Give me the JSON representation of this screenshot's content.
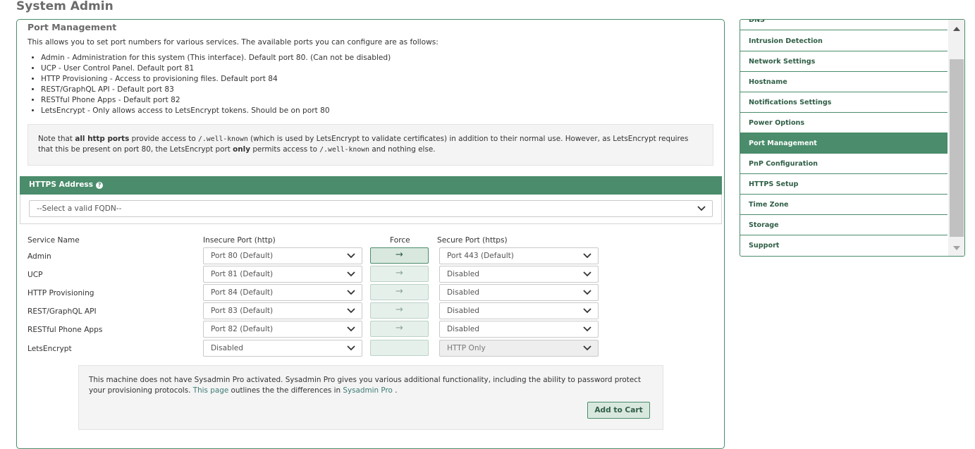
{
  "page_title": "System Admin",
  "panel": {
    "title": "Port Management",
    "intro": "This allows you to set port numbers for various services. The available ports you can configure are as follows:",
    "list": [
      "Admin - Administration for this system (This interface). Default port 80. (Can not be disabled)",
      "UCP - User Control Panel. Default port 81",
      "HTTP Provisioning - Access to provisioning files. Default port 84",
      "REST/GraphQL API - Default port 83",
      "RESTful Phone Apps - Default port 82",
      "LetsEncrypt - Only allows access to LetsEncrypt tokens. Should be on port 80"
    ]
  },
  "note": {
    "p1": "Note that ",
    "bold1": "all http ports",
    "p2": " provide access to ",
    "code1": "/.well-known",
    "p3": " (which is used by LetsEncrypt to validate certificates) in addition to their normal use. However, as LetsEncrypt requires that this be present on port 80, the LetsEncrypt port ",
    "bold2": "only",
    "p4": " permits access to ",
    "code2": "/.well-known",
    "p5": " and nothing else."
  },
  "https": {
    "label": "HTTPS Address",
    "help_icon": "question-circle-icon",
    "placeholder": "--Select a valid FQDN--"
  },
  "table": {
    "headers": {
      "service": "Service Name",
      "insecure": "Insecure Port (http)",
      "force": "Force",
      "secure": "Secure Port (https)"
    },
    "force_icon": "→",
    "rows": [
      {
        "service": "Admin",
        "insecure": "Port 80 (Default)",
        "secure": "Port 443 (Default)",
        "force": "active",
        "secure_disabled": false
      },
      {
        "service": "UCP",
        "insecure": "Port 81 (Default)",
        "secure": "Disabled",
        "force": "inactive",
        "secure_disabled": false
      },
      {
        "service": "HTTP Provisioning",
        "insecure": "Port 84 (Default)",
        "secure": "Disabled",
        "force": "inactive",
        "secure_disabled": false
      },
      {
        "service": "REST/GraphQL API",
        "insecure": "Port 83 (Default)",
        "secure": "Disabled",
        "force": "inactive",
        "secure_disabled": false
      },
      {
        "service": "RESTful Phone Apps",
        "insecure": "Port 82 (Default)",
        "secure": "Disabled",
        "force": "inactive",
        "secure_disabled": false
      },
      {
        "service": "LetsEncrypt",
        "insecure": "Disabled",
        "secure": "HTTP Only",
        "force": "empty",
        "secure_disabled": true
      }
    ]
  },
  "pro": {
    "text1": "This machine does not have Sysadmin Pro activated. Sysadmin Pro gives you various additional functionality, including the ability to password protect your provisioning protocols. ",
    "link1": "This page",
    "text2": " outlines the the differences in ",
    "link2": "Sysadmin Pro",
    "text3": " .",
    "button": "Add to Cart"
  },
  "sidebar": {
    "items": [
      {
        "label": "DNS",
        "active": false
      },
      {
        "label": "Intrusion Detection",
        "active": false
      },
      {
        "label": "Network Settings",
        "active": false
      },
      {
        "label": "Hostname",
        "active": false
      },
      {
        "label": "Notifications Settings",
        "active": false
      },
      {
        "label": "Power Options",
        "active": false
      },
      {
        "label": "Port Management",
        "active": true
      },
      {
        "label": "PnP Configuration",
        "active": false
      },
      {
        "label": "HTTPS Setup",
        "active": false
      },
      {
        "label": "Time Zone",
        "active": false
      },
      {
        "label": "Storage",
        "active": false
      },
      {
        "label": "Support",
        "active": false
      }
    ]
  },
  "colors": {
    "accent": "#4a8c6b",
    "link": "#3b7a73"
  }
}
